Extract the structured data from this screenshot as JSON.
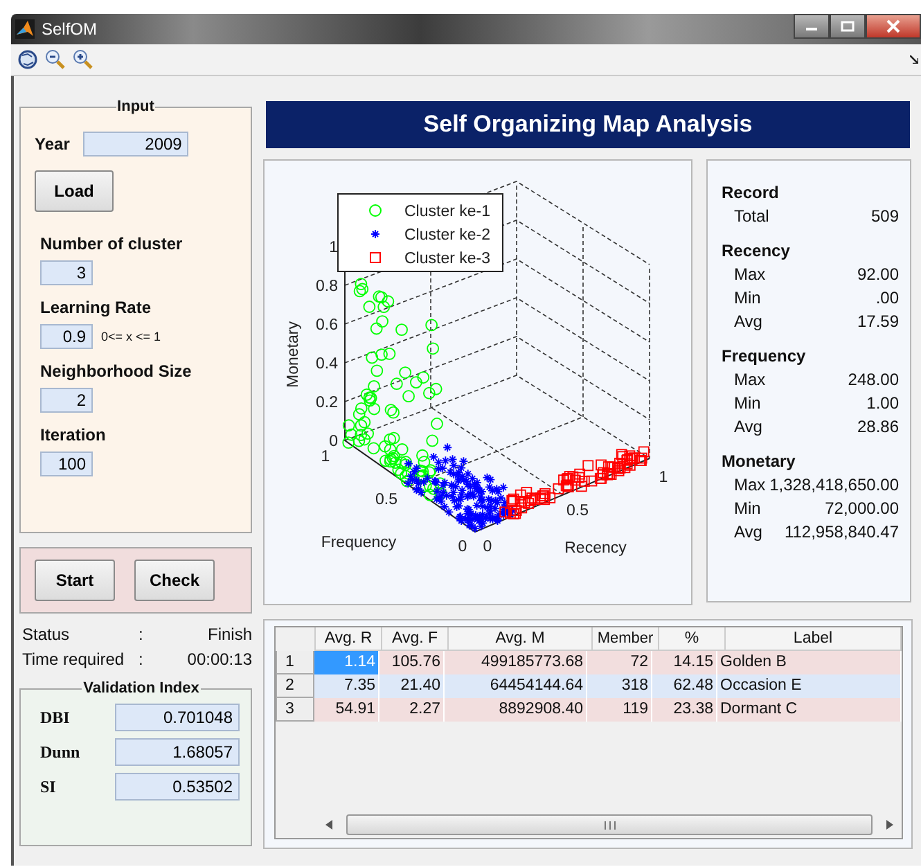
{
  "window": {
    "title": "SelfOM"
  },
  "input": {
    "title": "Input",
    "year_label": "Year",
    "year": "2009",
    "load": "Load",
    "fields": [
      {
        "label": "Number of cluster",
        "value": "3"
      },
      {
        "label": "Learning Rate",
        "value": "0.9",
        "hint": "0<= x <= 1"
      },
      {
        "label": "Neighborhood Size",
        "value": "2"
      },
      {
        "label": "Iteration",
        "value": "100"
      }
    ]
  },
  "actions": [
    "Start",
    "Check"
  ],
  "status": [
    {
      "label": "Status",
      "separator": ":",
      "value": "Finish"
    },
    {
      "label": "Time required",
      "separator": ":",
      "value": "00:00:13"
    }
  ],
  "validation": {
    "title": "Validation Index",
    "items": [
      {
        "label": "DBI",
        "value": "0.701048"
      },
      {
        "label": "Dunn",
        "value": "1.68057"
      },
      {
        "label": "SI",
        "value": "0.53502"
      }
    ]
  },
  "header": "Self Organizing Map Analysis",
  "plot": {
    "zlabel": "Monetary",
    "ylabel": "Frequency",
    "xlabel": "Recency",
    "zticks": [
      "1",
      "0.8",
      "0.6",
      "0.4",
      "0.2",
      "0"
    ],
    "yticks": [
      "1",
      "0.5",
      "0"
    ],
    "xticks": [
      "1",
      "0.5",
      "0"
    ],
    "legend": [
      {
        "label": "Cluster ke-1",
        "kind": "circle",
        "color": "#00ff00"
      },
      {
        "label": "Cluster ke-2",
        "kind": "star",
        "color": "#0000ff"
      },
      {
        "label": "Cluster ke-3",
        "kind": "square",
        "color": "#ff0000"
      }
    ]
  },
  "stats": [
    {
      "title": "Record",
      "rows": [
        {
          "label": "Total",
          "value": "509"
        }
      ]
    },
    {
      "title": "Recency",
      "rows": [
        {
          "label": "Max",
          "value": "92.00"
        },
        {
          "label": "Min",
          "value": ".00"
        },
        {
          "label": "Avg",
          "value": "17.59"
        }
      ]
    },
    {
      "title": "Frequency",
      "rows": [
        {
          "label": "Max",
          "value": "248.00"
        },
        {
          "label": "Min",
          "value": "1.00"
        },
        {
          "label": "Avg",
          "value": "28.86"
        }
      ]
    },
    {
      "title": "Monetary",
      "rows": [
        {
          "label": "Max",
          "value": "1,328,418,650.00"
        },
        {
          "label": "Min",
          "value": "72,000.00"
        },
        {
          "label": "Avg",
          "value": "112,958,840.47"
        }
      ]
    }
  ],
  "table": {
    "columns": [
      "Avg. R",
      "Avg. F",
      "Avg. M",
      "Member",
      "%",
      "Label"
    ],
    "rows": [
      {
        "header": "1",
        "cells": [
          {
            "text": "1.14",
            "selected": true
          },
          {
            "text": "105.76",
            "selected": false
          },
          {
            "text": "499185773.68",
            "selected": false
          },
          {
            "text": "72",
            "selected": false
          },
          {
            "text": "14.15",
            "selected": false
          },
          {
            "text": "Golden B",
            "selected": false
          }
        ]
      },
      {
        "header": "2",
        "cells": [
          {
            "text": "7.35",
            "selected": false
          },
          {
            "text": "21.40",
            "selected": false
          },
          {
            "text": "64454144.64",
            "selected": false
          },
          {
            "text": "318",
            "selected": false
          },
          {
            "text": "62.48",
            "selected": false
          },
          {
            "text": "Occasion E",
            "selected": false
          }
        ]
      },
      {
        "header": "3",
        "cells": [
          {
            "text": "54.91",
            "selected": false
          },
          {
            "text": "2.27",
            "selected": false
          },
          {
            "text": "8892908.40",
            "selected": false
          },
          {
            "text": "119",
            "selected": false
          },
          {
            "text": "23.38",
            "selected": false
          },
          {
            "text": "Dormant C",
            "selected": false
          }
        ]
      }
    ]
  }
}
